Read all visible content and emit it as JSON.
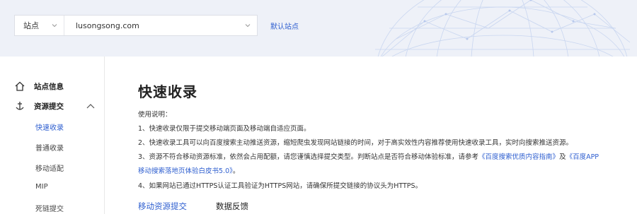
{
  "header": {
    "site_type_label": "站点",
    "site_domain": "lusongsong.com",
    "default_site_link": "默认站点"
  },
  "sidebar": {
    "items": [
      {
        "label": "站点信息",
        "icon": "home-icon"
      },
      {
        "label": "资源提交",
        "icon": "anchor-icon"
      }
    ],
    "sub_items": [
      {
        "label": "快速收录",
        "active": true
      },
      {
        "label": "普通收录",
        "active": false
      },
      {
        "label": "移动适配",
        "active": false
      },
      {
        "label": "MIP",
        "active": false
      },
      {
        "label": "死链提交",
        "active": false
      }
    ]
  },
  "main": {
    "title": "快速收录",
    "usage_heading": "使用说明：",
    "line1": "1、快速收录仅限于提交移动端页面及移动端自适应页面。",
    "line2": "2、快速收录工具可以向百度搜索主动推送资源，缩短爬虫发现网站链接的时间，对于高实效性内容推荐使用快速收录工具，实时向搜索推送资源。",
    "line3_text": "3、资源不符合移动资源标准，依然会占用配额，请您谨慎选择提交类型。判断站点是否符合移动体验标准，请参考",
    "line3_link1": "《百度搜索优质内容指南》",
    "line3_and": "及",
    "line3_link2a": "《百度APP",
    "line3_link2b": "移动搜索落地页体验白皮书5.0》",
    "line3_end": "。",
    "line4": "4、如果网站已通过HTTPS认证工具验证为HTTPS网站，请确保所提交链接的协议头为HTTPS。",
    "tabs": [
      {
        "label": "移动资源提交",
        "active": true
      },
      {
        "label": "数据反馈",
        "active": false
      }
    ]
  },
  "colors": {
    "accent": "#3060d0",
    "header_bg": "#eef1f8"
  }
}
